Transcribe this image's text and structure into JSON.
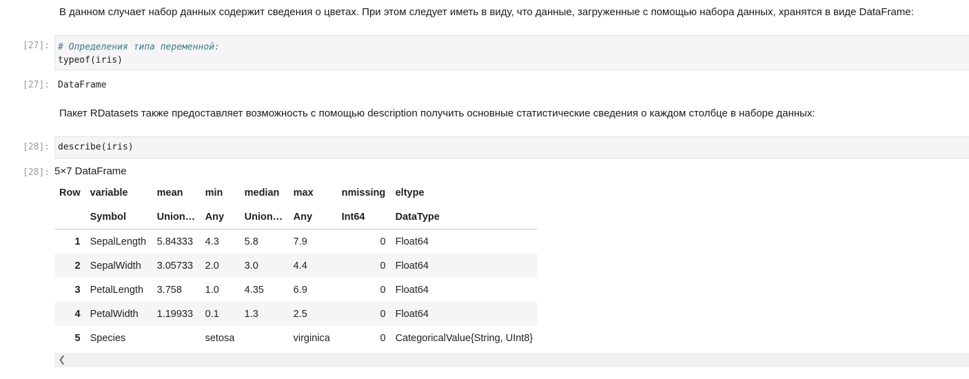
{
  "markdown1": "В данном случает набор данных содержит сведения о цветах. При этом следует иметь в виду, что данные, загруженные с помощью набора данных, хранятся в виде DataFrame:",
  "cell27": {
    "prompt_in": "[27]:",
    "comment": "# Определения типа переменной:",
    "code": "typeof(iris)",
    "prompt_out": "[27]:",
    "output": "DataFrame"
  },
  "markdown2": "Пакет RDatasets также предоставляет возможность с помощью description получить основные статистические сведения о каждом столбце в наборе данных:",
  "cell28": {
    "prompt_in": "[28]:",
    "code": "describe(iris)",
    "prompt_out": "[28]:",
    "caption": "5×7 DataFrame"
  },
  "table": {
    "headers": [
      "Row",
      "variable",
      "mean",
      "min",
      "median",
      "max",
      "nmissing",
      "eltype"
    ],
    "types": [
      "",
      "Symbol",
      "Union…",
      "Any",
      "Union…",
      "Any",
      "Int64",
      "DataType"
    ],
    "rows": [
      [
        "1",
        "SepalLength",
        "5.84333",
        "4.3",
        "5.8",
        "7.9",
        "0",
        "Float64"
      ],
      [
        "2",
        "SepalWidth",
        "3.05733",
        "2.0",
        "3.0",
        "4.4",
        "0",
        "Float64"
      ],
      [
        "3",
        "PetalLength",
        "3.758",
        "1.0",
        "4.35",
        "6.9",
        "0",
        "Float64"
      ],
      [
        "4",
        "PetalWidth",
        "1.19933",
        "0.1",
        "1.3",
        "2.5",
        "0",
        "Float64"
      ],
      [
        "5",
        "Species",
        "",
        "setosa",
        "",
        "virginica",
        "0",
        "CategoricalValue{String, UInt8}"
      ]
    ]
  },
  "scroll_left_icon": "chevron-left-icon"
}
